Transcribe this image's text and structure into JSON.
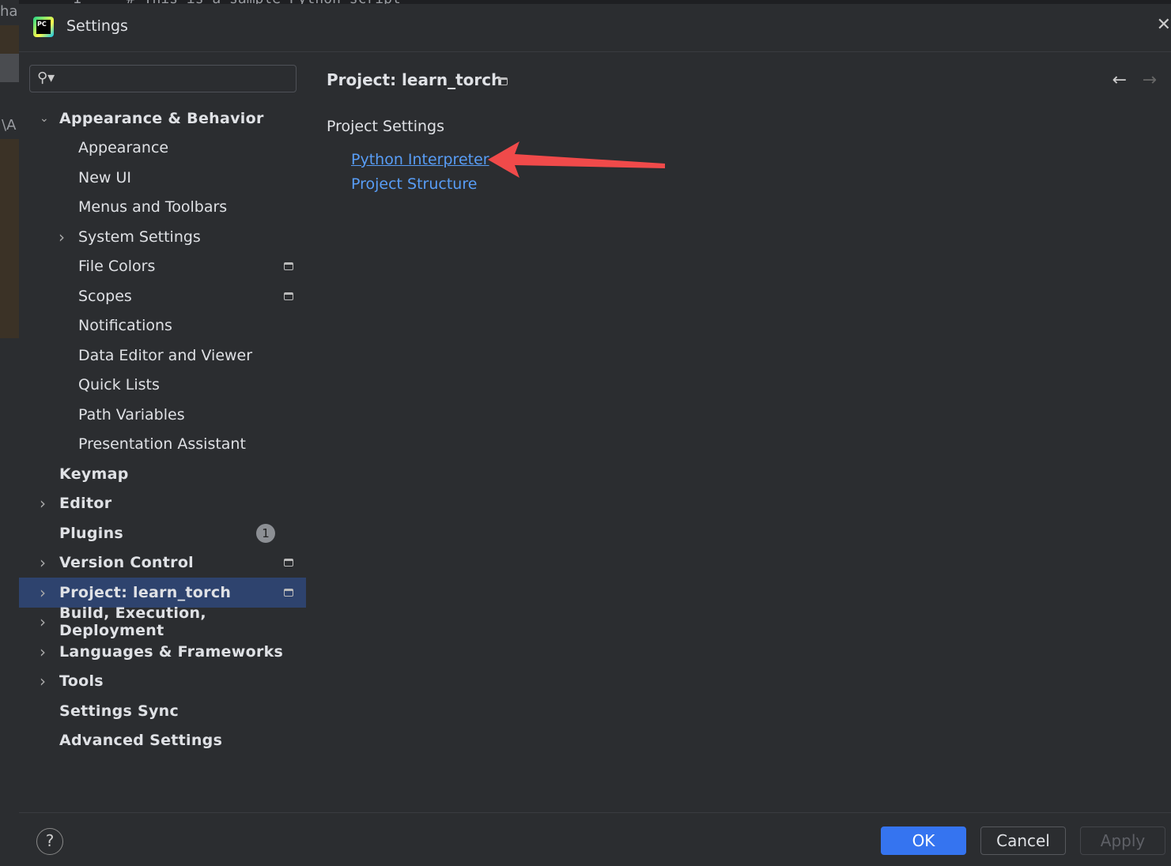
{
  "background": {
    "left_text_1": "har",
    "left_text_2": "\\A",
    "line_number": "1",
    "editor_line": "# This is a sample Python script"
  },
  "dialog": {
    "title": "Settings",
    "icon": "pycharm-logo",
    "logo_text": "PC"
  },
  "search": {
    "value": "",
    "placeholder": ""
  },
  "tree": [
    {
      "label": "Appearance & Behavior",
      "level": 0,
      "chevron": "down"
    },
    {
      "label": "Appearance",
      "level": 1
    },
    {
      "label": "New UI",
      "level": 1
    },
    {
      "label": "Menus and Toolbars",
      "level": 1
    },
    {
      "label": "System Settings",
      "level": 1,
      "chevron": "right"
    },
    {
      "label": "File Colors",
      "level": 1,
      "project_icon": true
    },
    {
      "label": "Scopes",
      "level": 1,
      "project_icon": true
    },
    {
      "label": "Notifications",
      "level": 1
    },
    {
      "label": "Data Editor and Viewer",
      "level": 1
    },
    {
      "label": "Quick Lists",
      "level": 1
    },
    {
      "label": "Path Variables",
      "level": 1
    },
    {
      "label": "Presentation Assistant",
      "level": 1
    },
    {
      "label": "Keymap",
      "level": 0
    },
    {
      "label": "Editor",
      "level": 0,
      "chevron": "right"
    },
    {
      "label": "Plugins",
      "level": 0,
      "badge": "1"
    },
    {
      "label": "Version Control",
      "level": 0,
      "chevron": "right",
      "project_icon": true
    },
    {
      "label": "Project: learn_torch",
      "level": 0,
      "chevron": "right",
      "project_icon": true,
      "selected": true
    },
    {
      "label": "Build, Execution, Deployment",
      "level": 0,
      "chevron": "right"
    },
    {
      "label": "Languages & Frameworks",
      "level": 0,
      "chevron": "right"
    },
    {
      "label": "Tools",
      "level": 0,
      "chevron": "right"
    },
    {
      "label": "Settings Sync",
      "level": 0
    },
    {
      "label": "Advanced Settings",
      "level": 0
    }
  ],
  "content": {
    "title": "Project: learn_torch",
    "subtitle": "Project Settings",
    "links": [
      "Python Interpreter",
      "Project Structure"
    ],
    "annotation_color": "#f04a4a"
  },
  "footer": {
    "ok": "OK",
    "cancel": "Cancel",
    "apply": "Apply",
    "help": "?"
  },
  "colors": {
    "accent": "#3574f0",
    "link": "#589df6",
    "selection": "#2e436e"
  }
}
